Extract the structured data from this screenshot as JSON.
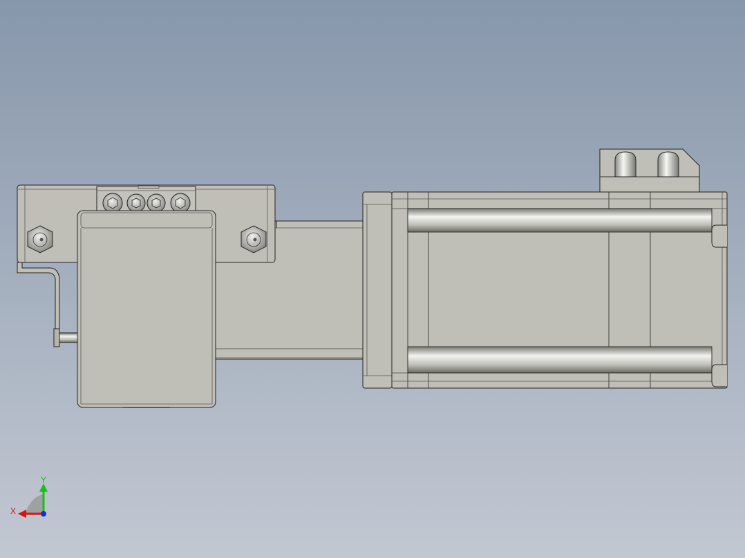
{
  "viewport": {
    "background_top": "#8797ab",
    "background_bottom": "#c2c8d2"
  },
  "model": {
    "body_color": "#c0bfb7",
    "edge_color": "#222222",
    "highlight_color": "#f2f2ee",
    "shadow_color": "#6e6e68"
  },
  "triad": {
    "x_label": "X",
    "y_label": "Y",
    "x_color": "#e01010",
    "y_color": "#18c018",
    "z_color": "#1a2ad8"
  }
}
